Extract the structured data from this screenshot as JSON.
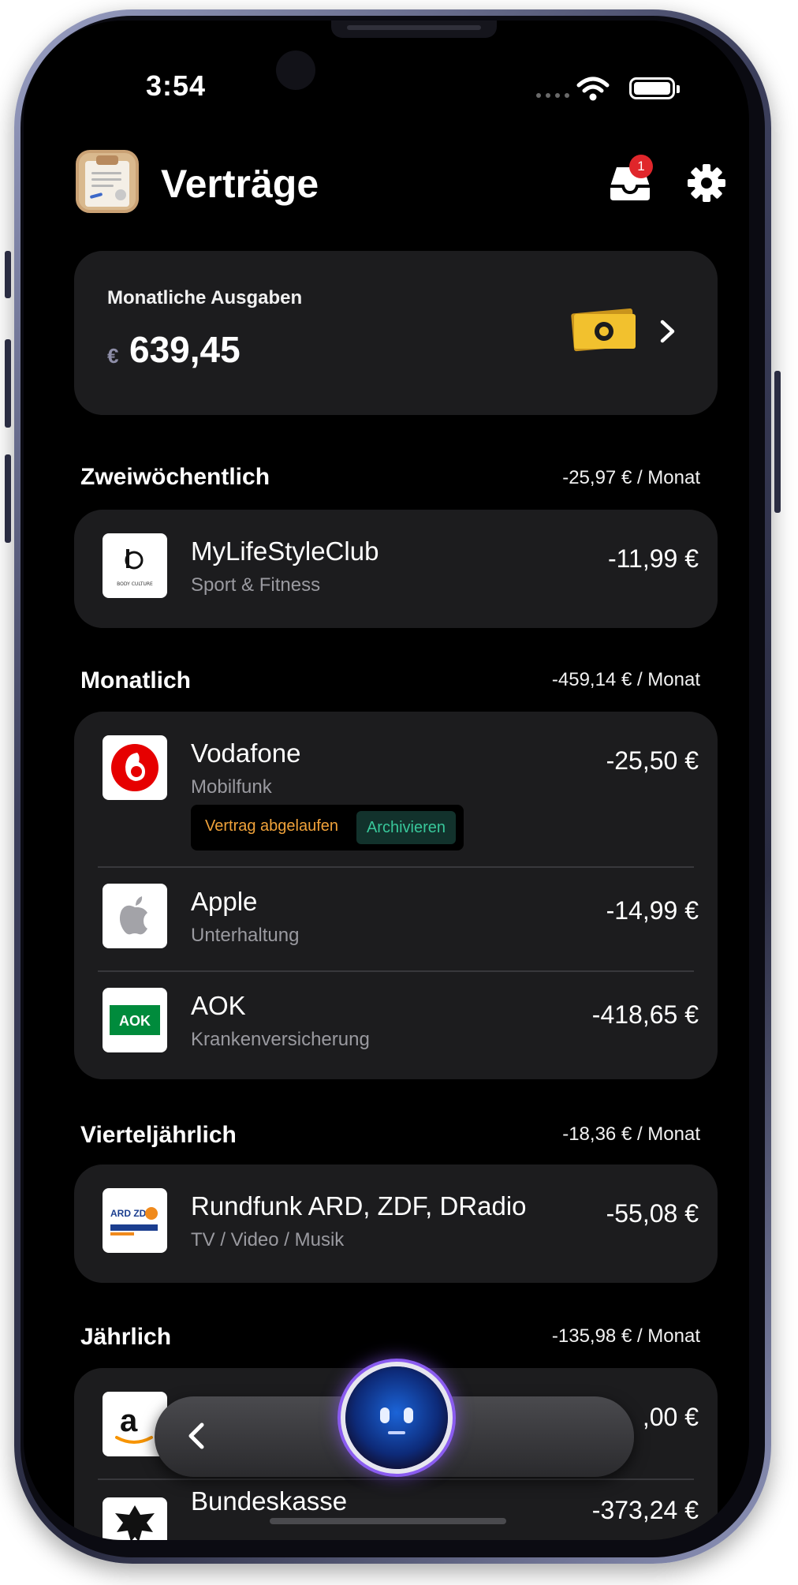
{
  "status_bar": {
    "time": "3:54"
  },
  "header": {
    "title": "Verträge",
    "inbox_badge": "1"
  },
  "summary": {
    "label": "Monatliche Ausgaben",
    "currency": "€",
    "amount": "639,45"
  },
  "sections": [
    {
      "title": "Zweiwöchentlich",
      "total": "-25,97 € / Monat",
      "items": [
        {
          "name": "MyLifeStyleClub",
          "category": "Sport & Fitness",
          "amount": "-11,99 €",
          "logo": "body-culture-logo",
          "logo_text": "BODY CULTURE"
        }
      ]
    },
    {
      "title": "Monatlich",
      "total": "-459,14 € / Monat",
      "items": [
        {
          "name": "Vodafone",
          "category": "Mobilfunk",
          "amount": "-25,50 €",
          "logo": "vodafone-logo",
          "status": "Vertrag abgelaufen",
          "action": "Archivieren"
        },
        {
          "name": "Apple",
          "category": "Unterhaltung",
          "amount": "-14,99 €",
          "logo": "apple-logo"
        },
        {
          "name": "AOK",
          "category": "Krankenversicherung",
          "amount": "-418,65 €",
          "logo": "aok-logo",
          "logo_text": "AOK"
        }
      ]
    },
    {
      "title": "Vierteljährlich",
      "total": "-18,36 € / Monat",
      "items": [
        {
          "name": "Rundfunk ARD, ZDF, DRadio",
          "category": "TV / Video / Musik",
          "amount": "-55,08 €",
          "logo": "ard-zdf-logo",
          "logo_text": "ARD ZDF"
        }
      ]
    },
    {
      "title": "Jährlich",
      "total": "-135,98 € / Monat",
      "items": [
        {
          "name": "",
          "category": "",
          "amount": ",00 €",
          "logo": "amazon-logo",
          "logo_text": "a"
        },
        {
          "name": "Bundeskasse",
          "category": "",
          "amount": "-373,24 €",
          "logo": "bundesadler-logo"
        }
      ]
    }
  ],
  "colors": {
    "card_bg": "#1c1c1e",
    "expired": "#f0a23a",
    "archive": "#38c79a",
    "badge": "#e0262b",
    "cash": "#f2c12e"
  },
  "icons": [
    "wifi-icon",
    "battery-icon",
    "inbox-icon",
    "gear-icon",
    "cash-icon",
    "chevron-right-icon",
    "chevron-left-icon",
    "assistant-icon"
  ]
}
